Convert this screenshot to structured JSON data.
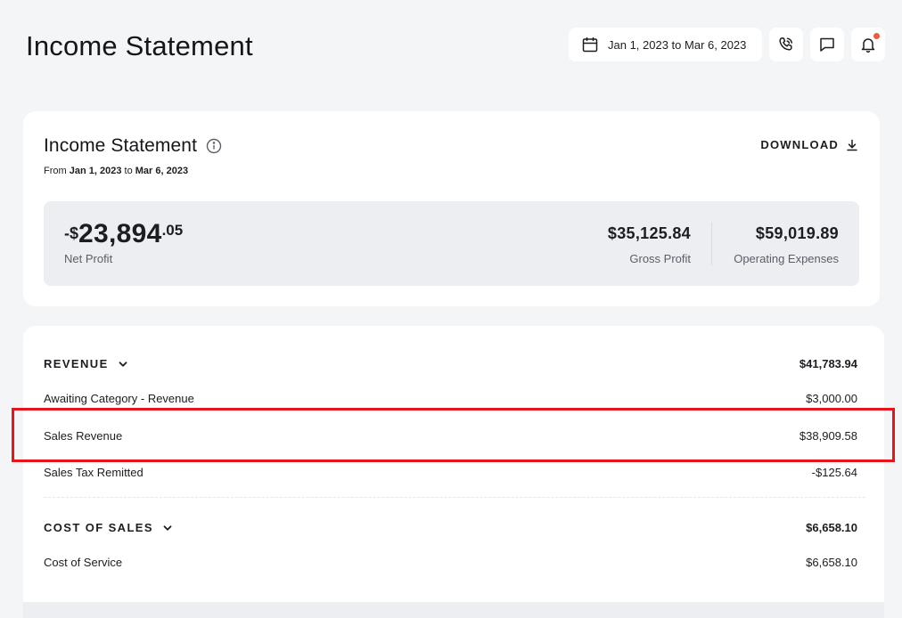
{
  "header": {
    "title": "Income Statement",
    "date_range": "Jan 1, 2023 to Mar 6, 2023",
    "icons": [
      "calendar-icon",
      "phone-icon",
      "chat-icon",
      "bell-icon"
    ],
    "notification_dot_color": "#ee5a3c"
  },
  "summary": {
    "title": "Income Statement",
    "from_label": "From",
    "from_date": "Jan 1, 2023",
    "to_label": "to",
    "to_date": "Mar 6, 2023",
    "download_label": "DOWNLOAD",
    "net_profit": {
      "prefix": "-$",
      "main": "23,894",
      "cents": ".05",
      "label": "Net Profit"
    },
    "gross_profit": {
      "value": "$35,125.84",
      "label": "Gross Profit"
    },
    "operating_expenses": {
      "value": "$59,019.89",
      "label": "Operating Expenses"
    }
  },
  "sections": [
    {
      "name": "REVENUE",
      "total": "$41,783.94",
      "rows": [
        {
          "label": "Awaiting Category - Revenue",
          "value": "$3,000.00"
        },
        {
          "label": "Sales Revenue",
          "value": "$38,909.58"
        },
        {
          "label": "Sales Tax Remitted",
          "value": "-$125.64"
        }
      ]
    },
    {
      "name": "COST OF SALES",
      "total": "$6,658.10",
      "rows": [
        {
          "label": "Cost of Service",
          "value": "$6,658.10"
        }
      ]
    }
  ],
  "colors": {
    "highlight": "#e8141c",
    "background": "#f4f5f7",
    "metrics_panel": "#eceef2"
  }
}
